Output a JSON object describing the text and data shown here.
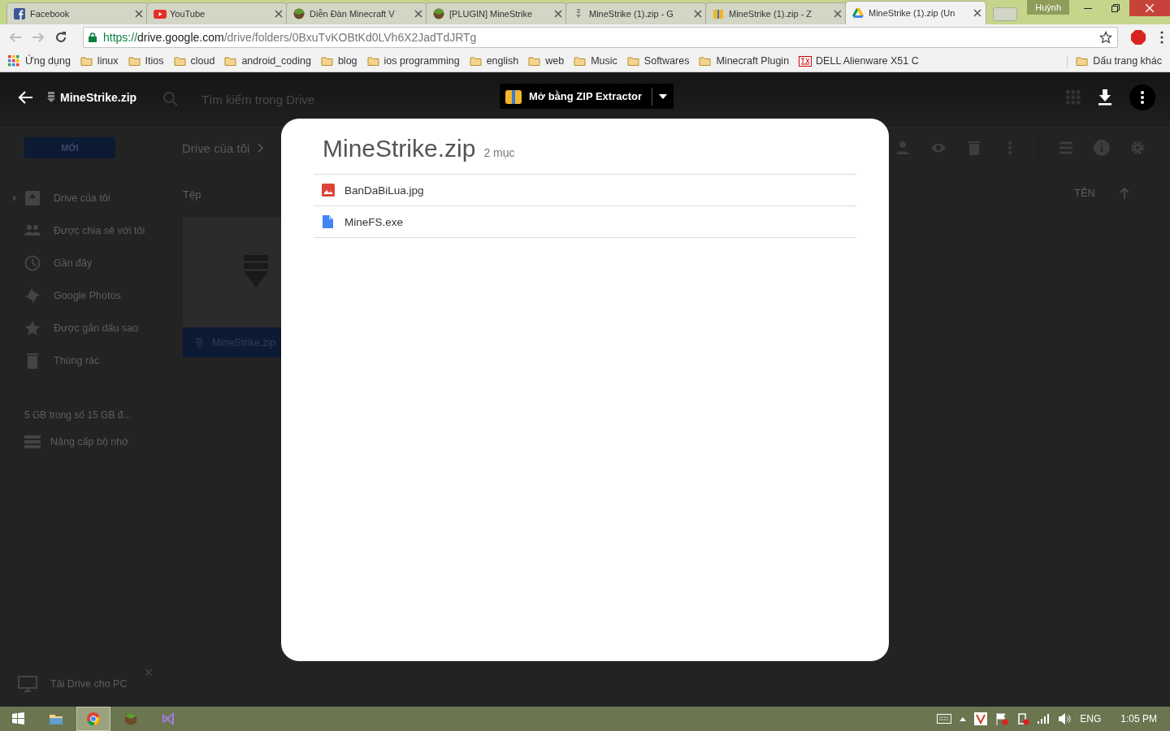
{
  "browser": {
    "tabs": [
      {
        "title": "Facebook",
        "kind": "facebook",
        "selected": false
      },
      {
        "title": "YouTube",
        "kind": "youtube",
        "selected": false
      },
      {
        "title": "Diễn Đàn Minecraft V",
        "kind": "minecraft",
        "selected": false
      },
      {
        "title": "[PLUGIN] MineStrike",
        "kind": "minecraft",
        "selected": false
      },
      {
        "title": "MineStrike (1).zip - G",
        "kind": "zipfile",
        "selected": false
      },
      {
        "title": "MineStrike (1).zip - Z",
        "kind": "archive",
        "selected": false
      },
      {
        "title": "MineStrike (1).zip (Un",
        "kind": "drive",
        "selected": true
      }
    ],
    "profile": "Huỳnh",
    "address": {
      "scheme": "https://",
      "host": "drive.google.com",
      "path": "/drive/folders/0BxuTvKOBtKd0LVh6X2JadTdJRTg"
    },
    "bookmarks": [
      {
        "label": "Ứng dụng",
        "kind": "apps"
      },
      {
        "label": "linux",
        "kind": "folder"
      },
      {
        "label": "Itios",
        "kind": "folder"
      },
      {
        "label": "cloud",
        "kind": "folder"
      },
      {
        "label": "android_coding",
        "kind": "folder"
      },
      {
        "label": "blog",
        "kind": "folder"
      },
      {
        "label": "ios programming",
        "kind": "folder"
      },
      {
        "label": "english",
        "kind": "folder"
      },
      {
        "label": "web",
        "kind": "folder"
      },
      {
        "label": "Music",
        "kind": "folder"
      },
      {
        "label": "Softwares",
        "kind": "folder"
      },
      {
        "label": "Minecraft Plugin",
        "kind": "folder"
      },
      {
        "label": "DELL Alienware X51 C",
        "kind": "site"
      }
    ],
    "other_bookmarks": "Dấu trang khác"
  },
  "drive": {
    "search": {
      "placeholder": "Tìm kiếm trong Drive"
    },
    "new_button": "MỚI",
    "breadcrumb": [
      "Drive của tôi"
    ],
    "sidebar": {
      "items": [
        {
          "label": "Drive của tôi",
          "kind": "drive"
        },
        {
          "label": "Được chia sẻ với tôi",
          "kind": "shared"
        },
        {
          "label": "Gần đây",
          "kind": "recent"
        },
        {
          "label": "Google Photos",
          "kind": "photos"
        },
        {
          "label": "Được gắn dấu sao",
          "kind": "starred"
        },
        {
          "label": "Thùng rác",
          "kind": "trash"
        }
      ],
      "storage": "5 GB trong số 15 GB đ...",
      "upgrade": "Nâng cấp bộ nhớ",
      "download_promo": "Tải Drive cho PC"
    },
    "section_label": "Tệp",
    "file_card": {
      "name": "MineStrike.zip"
    },
    "sort_column": "TÊN"
  },
  "preview": {
    "file_name": "MineStrike.zip",
    "open_with": "Mở bằng ZIP Extractor"
  },
  "archive": {
    "title": "MineStrike.zip",
    "count": "2 mục",
    "files": [
      {
        "name": "BanDaBiLua.jpg",
        "kind": "image"
      },
      {
        "name": "MineFS.exe",
        "kind": "file"
      }
    ]
  },
  "taskbar": {
    "language": "ENG",
    "time": "1:05 PM"
  }
}
